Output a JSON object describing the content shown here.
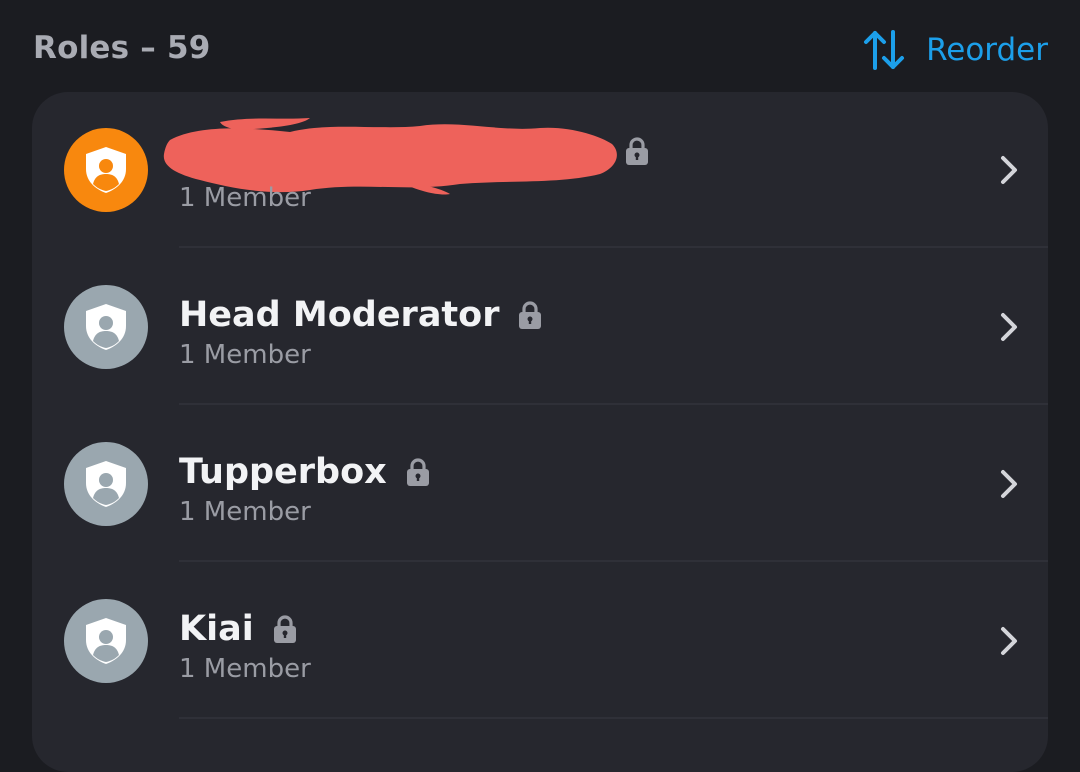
{
  "header": {
    "title": "Roles – 59",
    "reorder_label": "Reorder",
    "reorder_icon": "sort-arrows-icon"
  },
  "colors": {
    "background": "#1b1c21",
    "card": "#26272e",
    "accent": "#1c9fea",
    "avatar_highlight": "#f8880e",
    "avatar_default": "#9aa7af",
    "redaction": "#ee625b"
  },
  "roles": [
    {
      "name": "",
      "member_count": "1 Member",
      "locked": true,
      "avatar_color": "#f8880e",
      "redacted": true
    },
    {
      "name": "Head Moderator",
      "member_count": "1 Member",
      "locked": true,
      "avatar_color": "#9aa7af",
      "redacted": false
    },
    {
      "name": "Tupperbox",
      "member_count": "1 Member",
      "locked": true,
      "avatar_color": "#9aa7af",
      "redacted": false
    },
    {
      "name": "Kiai",
      "member_count": "1 Member",
      "locked": true,
      "avatar_color": "#9aa7af",
      "redacted": false
    }
  ]
}
